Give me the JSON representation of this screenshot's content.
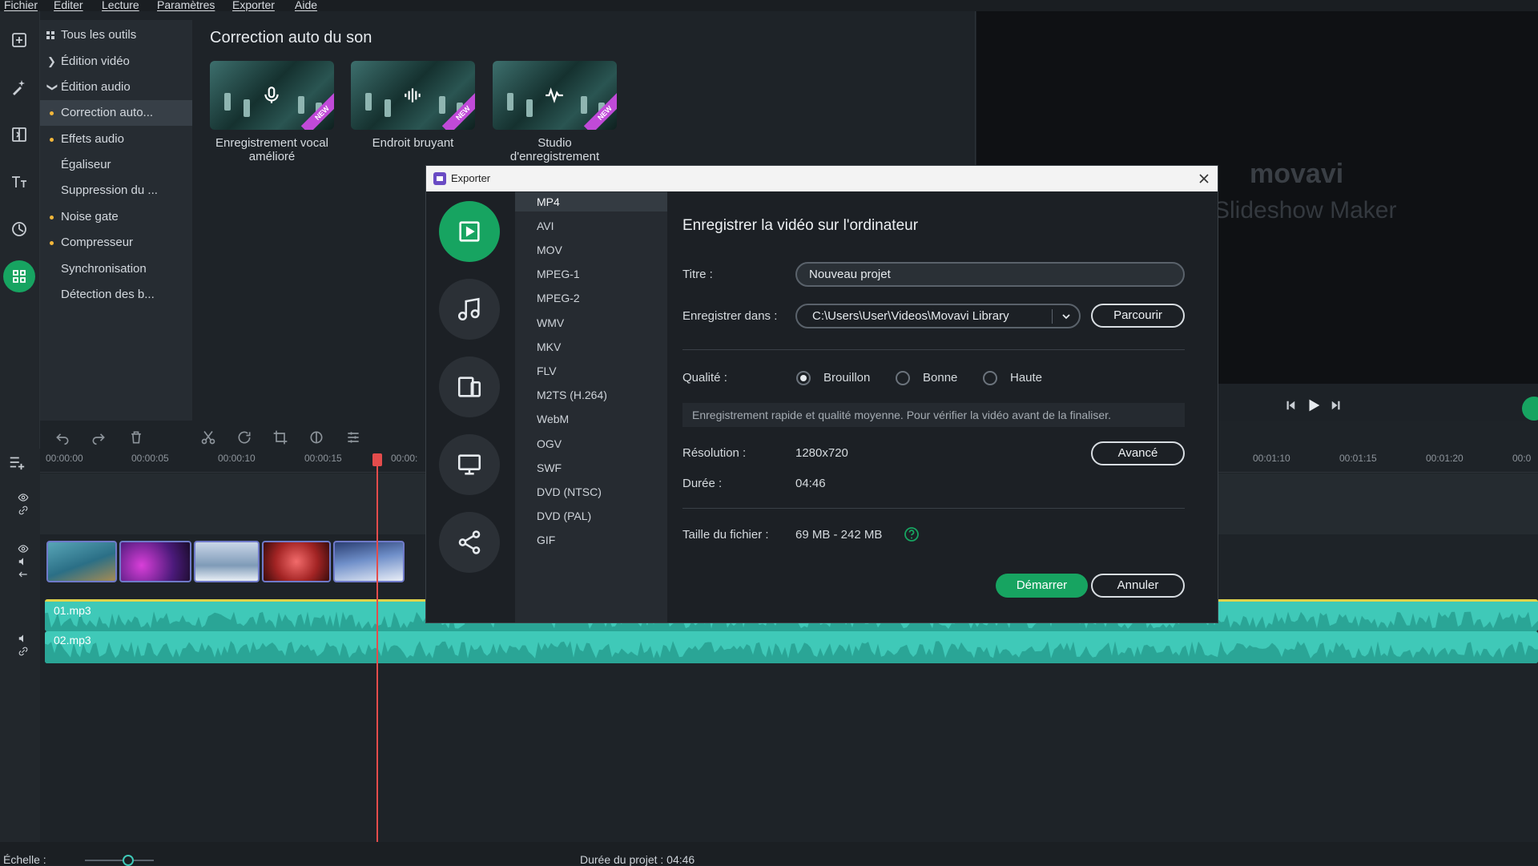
{
  "menu": [
    "Fichier",
    "Editer",
    "Lecture",
    "Paramètres",
    "Exporter",
    "Aide"
  ],
  "rail_icons": [
    "import-icon",
    "magic-wand-icon",
    "transitions-icon",
    "titles-icon",
    "clock-icon",
    "tools-grid-icon"
  ],
  "tools": {
    "items": [
      {
        "label": "Tous les outils"
      },
      {
        "label": "Édition vidéo"
      },
      {
        "label": "Édition audio"
      },
      {
        "label": "Correction auto..."
      },
      {
        "label": "Effets audio"
      },
      {
        "label": "Égaliseur"
      },
      {
        "label": "Suppression du ..."
      },
      {
        "label": "Noise gate"
      },
      {
        "label": "Compresseur"
      },
      {
        "label": "Synchronisation"
      },
      {
        "label": "Détection des b..."
      }
    ]
  },
  "main": {
    "title": "Correction auto du son",
    "cards": [
      {
        "label": "Enregistrement vocal amélioré",
        "badge": "NEW"
      },
      {
        "label": "Endroit bruyant",
        "badge": "NEW"
      },
      {
        "label": "Studio d'enregistrement",
        "badge": "NEW"
      }
    ]
  },
  "preview": {
    "logo": "movavi",
    "subtitle": "Slideshow Maker"
  },
  "ruler_ticks": [
    "00:00:00",
    "00:00:05",
    "00:00:10",
    "00:00:15",
    "00:00:",
    "00:01:10",
    "00:01:15",
    "00:01:20",
    "00:0"
  ],
  "audio_tracks": [
    {
      "label": "01.mp3"
    },
    {
      "label": "02.mp3"
    }
  ],
  "status": {
    "scale_label": "Échelle :",
    "project_duration": "Durée du projet : 04:46"
  },
  "modal": {
    "title": "Exporter",
    "formats": [
      "MP4",
      "AVI",
      "MOV",
      "MPEG-1",
      "MPEG-2",
      "WMV",
      "MKV",
      "FLV",
      "M2TS (H.264)",
      "WebM",
      "OGV",
      "SWF",
      "DVD (NTSC)",
      "DVD (PAL)",
      "GIF"
    ],
    "selected_format": "MP4",
    "heading": "Enregistrer la vidéo sur l'ordinateur",
    "title_label": "Titre :",
    "title_value": "Nouveau projet",
    "save_label": "Enregistrer dans :",
    "save_path": "C:\\Users\\User\\Videos\\Movavi Library",
    "browse": "Parcourir",
    "quality_label": "Qualité :",
    "quality_options": [
      "Brouillon",
      "Bonne",
      "Haute"
    ],
    "quality_selected": "Brouillon",
    "hint": "Enregistrement rapide et qualité moyenne. Pour vérifier la vidéo avant de la finaliser.",
    "resolution_label": "Résolution :",
    "resolution_value": "1280x720",
    "advanced": "Avancé",
    "duration_label": "Durée :",
    "duration_value": "04:46",
    "filesize_label": "Taille du fichier :",
    "filesize_value": "69 MB - 242 MB",
    "start": "Démarrer",
    "cancel": "Annuler"
  },
  "colors": {
    "accent": "#17a461",
    "playhead": "#e44c4c",
    "audio": "#3fc9b8",
    "new_badge": "#c04ad8"
  }
}
